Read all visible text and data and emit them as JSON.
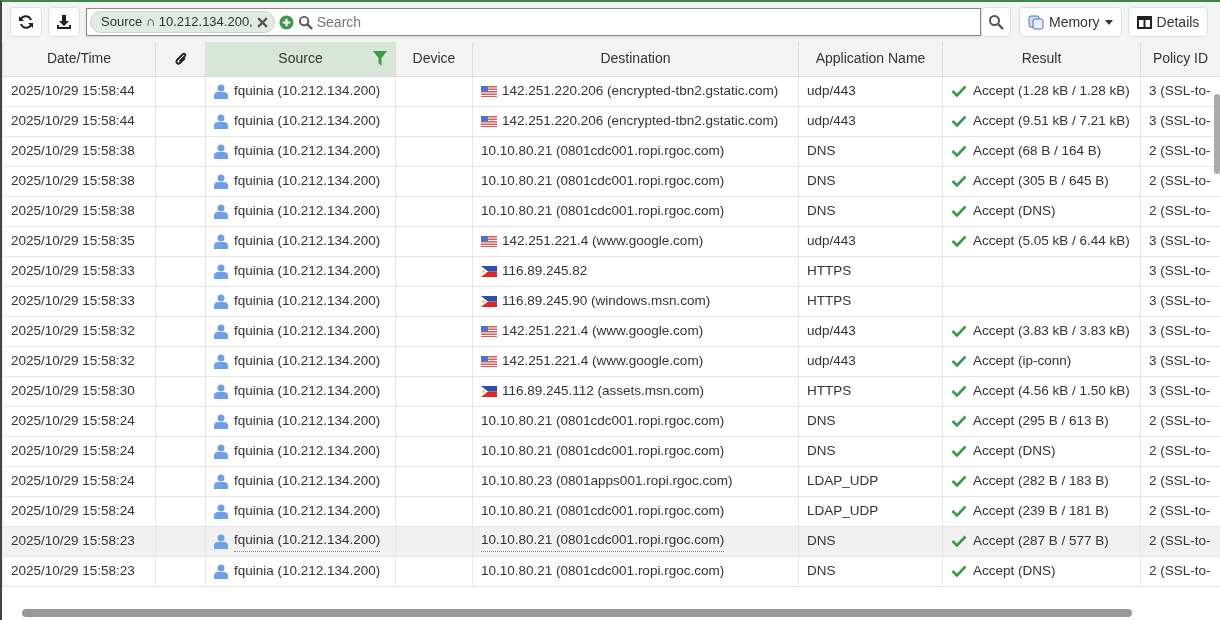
{
  "toolbar": {
    "filter_chip": "Source ∩ 10.212.134.200,",
    "search": {
      "placeholder": "Search"
    },
    "memory_button": "Memory",
    "details_button": "Details"
  },
  "table": {
    "columns": [
      {
        "label": "Date/Time",
        "kind": "text"
      },
      {
        "kind": "attachment"
      },
      {
        "label": "Source",
        "kind": "filtered"
      },
      {
        "label": "Device",
        "kind": "text"
      },
      {
        "label": "Destination",
        "kind": "text"
      },
      {
        "label": "Application Name",
        "kind": "text"
      },
      {
        "label": "Result",
        "kind": "text"
      },
      {
        "label": "Policy ID",
        "kind": "text"
      }
    ],
    "rows": [
      {
        "kind": "us",
        "time": "2025/10/29 15:58:44",
        "source": "fquinia (10.212.134.200)",
        "destination": "142.251.220.206 (encrypted-tbn2.gstatic.com)",
        "application": "udp/443",
        "result": "Accept (1.28 kB / 1.28 kB)",
        "policy": "3 (SSL-to-",
        "selected": false
      },
      {
        "kind": "us",
        "time": "2025/10/29 15:58:44",
        "source": "fquinia (10.212.134.200)",
        "destination": "142.251.220.206 (encrypted-tbn2.gstatic.com)",
        "application": "udp/443",
        "result": "Accept (9.51 kB / 7.21 kB)",
        "policy": "3 (SSL-to-",
        "selected": false
      },
      {
        "kind": "local",
        "time": "2025/10/29 15:58:38",
        "source": "fquinia (10.212.134.200)",
        "destination": "10.10.80.21 (0801cdc001.ropi.rgoc.com)",
        "application": "DNS",
        "result": "Accept (68 B / 164 B)",
        "policy": "2 (SSL-to-",
        "selected": false
      },
      {
        "kind": "local",
        "time": "2025/10/29 15:58:38",
        "source": "fquinia (10.212.134.200)",
        "destination": "10.10.80.21 (0801cdc001.ropi.rgoc.com)",
        "application": "DNS",
        "result": "Accept (305 B / 645 B)",
        "policy": "2 (SSL-to-",
        "selected": false
      },
      {
        "kind": "local",
        "time": "2025/10/29 15:58:38",
        "source": "fquinia (10.212.134.200)",
        "destination": "10.10.80.21 (0801cdc001.ropi.rgoc.com)",
        "application": "DNS",
        "result": "Accept (DNS)",
        "policy": "2 (SSL-to-",
        "selected": false
      },
      {
        "kind": "us",
        "time": "2025/10/29 15:58:35",
        "source": "fquinia (10.212.134.200)",
        "destination": "142.251.221.4 (www.google.com)",
        "application": "udp/443",
        "result": "Accept (5.05 kB / 6.44 kB)",
        "policy": "3 (SSL-to-",
        "selected": false
      },
      {
        "kind": "ph",
        "time": "2025/10/29 15:58:33",
        "source": "fquinia (10.212.134.200)",
        "destination": "116.89.245.82",
        "application": "HTTPS",
        "policy": "3 (SSL-to-",
        "selected": false
      },
      {
        "kind": "ph",
        "time": "2025/10/29 15:58:33",
        "source": "fquinia (10.212.134.200)",
        "destination": "116.89.245.90 (windows.msn.com)",
        "application": "HTTPS",
        "policy": "3 (SSL-to-",
        "selected": false
      },
      {
        "kind": "us",
        "time": "2025/10/29 15:58:32",
        "source": "fquinia (10.212.134.200)",
        "destination": "142.251.221.4 (www.google.com)",
        "application": "udp/443",
        "result": "Accept (3.83 kB / 3.83 kB)",
        "policy": "3 (SSL-to-",
        "selected": false
      },
      {
        "kind": "us",
        "time": "2025/10/29 15:58:32",
        "source": "fquinia (10.212.134.200)",
        "destination": "142.251.221.4 (www.google.com)",
        "application": "udp/443",
        "result": "Accept (ip-conn)",
        "policy": "3 (SSL-to-",
        "selected": false
      },
      {
        "kind": "ph",
        "time": "2025/10/29 15:58:30",
        "source": "fquinia (10.212.134.200)",
        "destination": "116.89.245.112 (assets.msn.com)",
        "application": "HTTPS",
        "result": "Accept (4.56 kB / 1.50 kB)",
        "policy": "3 (SSL-to-",
        "selected": false
      },
      {
        "kind": "local",
        "time": "2025/10/29 15:58:24",
        "source": "fquinia (10.212.134.200)",
        "destination": "10.10.80.21 (0801cdc001.ropi.rgoc.com)",
        "application": "DNS",
        "result": "Accept (295 B / 613 B)",
        "policy": "2 (SSL-to-",
        "selected": false
      },
      {
        "kind": "local",
        "time": "2025/10/29 15:58:24",
        "source": "fquinia (10.212.134.200)",
        "destination": "10.10.80.21 (0801cdc001.ropi.rgoc.com)",
        "application": "DNS",
        "result": "Accept (DNS)",
        "policy": "2 (SSL-to-",
        "selected": false
      },
      {
        "kind": "local",
        "time": "2025/10/29 15:58:24",
        "source": "fquinia (10.212.134.200)",
        "destination": "10.10.80.23 (0801apps001.ropi.rgoc.com)",
        "application": "LDAP_UDP",
        "result": "Accept (282 B / 183 B)",
        "policy": "2 (SSL-to-",
        "selected": false
      },
      {
        "kind": "local",
        "time": "2025/10/29 15:58:24",
        "source": "fquinia (10.212.134.200)",
        "destination": "10.10.80.21 (0801cdc001.ropi.rgoc.com)",
        "application": "LDAP_UDP",
        "result": "Accept (239 B / 181 B)",
        "policy": "2 (SSL-to-",
        "selected": false
      },
      {
        "kind": "local",
        "time": "2025/10/29 15:58:23",
        "source": "fquinia (10.212.134.200)",
        "destination": "10.10.80.21 (0801cdc001.ropi.rgoc.com)",
        "application": "DNS",
        "result": "Accept (287 B / 577 B)",
        "policy": "2 (SSL-to-",
        "selected": true
      },
      {
        "kind": "local",
        "time": "2025/10/29 15:58:23",
        "source": "fquinia (10.212.134.200)",
        "destination": "10.10.80.21 (0801cdc001.ropi.rgoc.com)",
        "application": "DNS",
        "result": "Accept (DNS)",
        "policy": "2 (SSL-to-",
        "selected": false
      }
    ]
  }
}
